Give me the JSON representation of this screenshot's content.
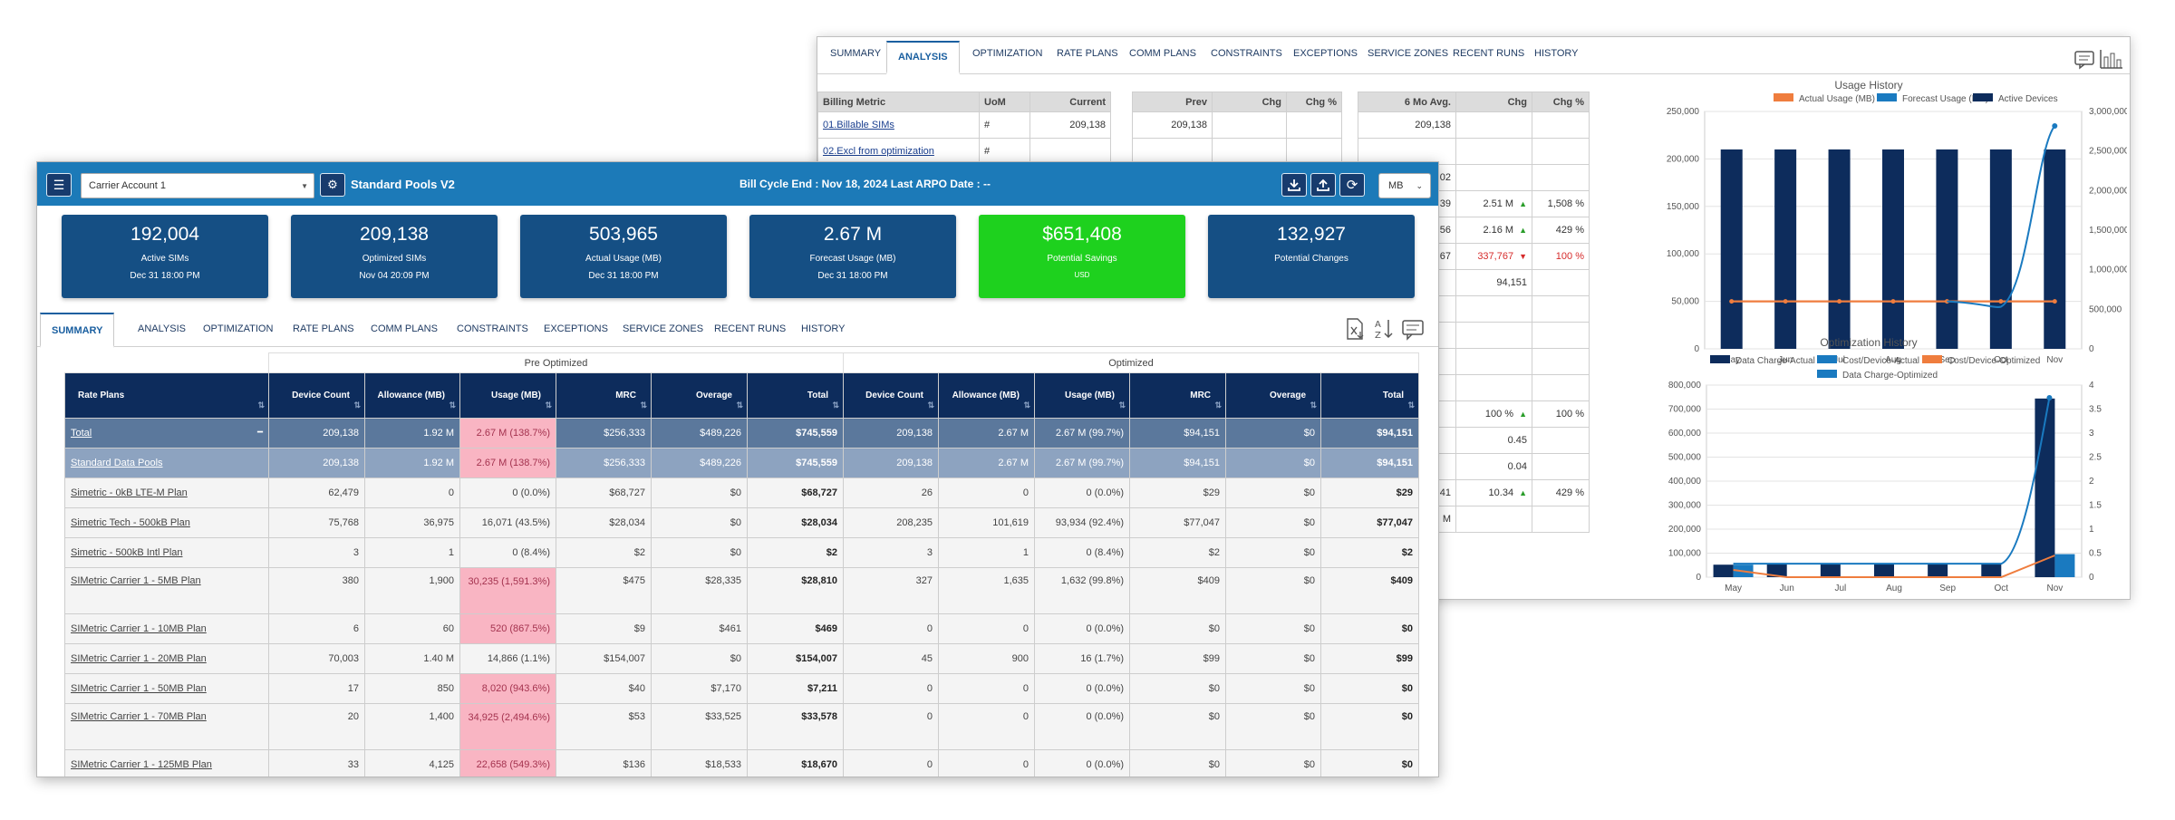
{
  "back": {
    "tabs": [
      "SUMMARY",
      "ANALYSIS",
      "OPTIMIZATION",
      "RATE PLANS",
      "COMM PLANS",
      "CONSTRAINTS",
      "EXCEPTIONS",
      "SERVICE ZONES",
      "RECENT RUNS",
      "HISTORY"
    ],
    "active_tab": "ANALYSIS",
    "metric_table": {
      "headers": [
        "Billing Metric",
        "UoM",
        "Current"
      ],
      "rows": [
        [
          "01.Billable SIMs",
          "#",
          "209,138"
        ],
        [
          "02.Excl from optimization",
          "#",
          ""
        ]
      ]
    },
    "prev_table": {
      "headers": [
        "Prev",
        "Chg",
        "Chg %"
      ],
      "rows": [
        [
          "209,138",
          "",
          ""
        ]
      ]
    },
    "avg_table": {
      "headers": [
        "6 Mo Avg.",
        "Chg",
        "Chg %"
      ],
      "rows": [
        [
          "209,138",
          "",
          ""
        ],
        [
          "",
          "",
          ""
        ],
        [
          "02",
          "",
          ""
        ],
        [
          "39",
          "2.51 M",
          "1,508 %"
        ],
        [
          "56",
          "2.16 M",
          "429 %"
        ],
        [
          "67",
          "337,767",
          "100 %"
        ],
        [
          "",
          "94,151",
          ""
        ],
        [
          "",
          "",
          ""
        ],
        [
          "",
          "",
          ""
        ],
        [
          "",
          "",
          ""
        ],
        [
          "",
          "",
          ""
        ],
        [
          "",
          "100 %",
          "100 %"
        ],
        [
          "",
          "0.45",
          ""
        ],
        [
          "",
          "0.04",
          ""
        ],
        [
          "41",
          "10.34",
          "429 %"
        ],
        [
          "M",
          "",
          ""
        ]
      ]
    },
    "usage_chart": {
      "title": "Usage History",
      "legend": [
        "Actual Usage (MB)",
        "Forecast Usage (MB)",
        "Active Devices"
      ],
      "y_left_ticks": [
        "250,000",
        "200,000",
        "150,000",
        "100,000",
        "50,000",
        "0"
      ],
      "y_right_ticks": [
        "3,000,000",
        "2,500,000",
        "2,000,000",
        "1,500,000",
        "1,000,000",
        "500,000",
        "0"
      ],
      "x": [
        "May",
        "Jun",
        "Jul",
        "Aug",
        "Sep",
        "Oct",
        "Nov"
      ]
    },
    "opt_chart": {
      "title": "Optimization History",
      "legend": [
        "Data Charge-Actual",
        "Cost/Device-Actual",
        "Cost/Device-Optimized",
        "Data Charge-Optimized"
      ],
      "y_left_ticks": [
        "800,000",
        "700,000",
        "600,000",
        "500,000",
        "400,000",
        "300,000",
        "200,000",
        "100,000",
        "0"
      ],
      "y_right_ticks": [
        "4",
        "3.5",
        "3",
        "2.5",
        "2",
        "1.5",
        "1",
        "0.5",
        "0"
      ],
      "x": [
        "May",
        "Jun",
        "Jul",
        "Aug",
        "Sep",
        "Oct",
        "Nov"
      ]
    }
  },
  "front": {
    "account": "Carrier Account 1",
    "pool_title": "Standard Pools V2",
    "cycle": "Bill Cycle End : Nov 18, 2024 Last ARPO Date : --",
    "unit": "MB",
    "kpis": [
      {
        "value": "192,004",
        "label": "Active SIMs",
        "date": "Dec 31 18:00 PM"
      },
      {
        "value": "209,138",
        "label": "Optimized SIMs",
        "date": "Nov 04 20:09 PM"
      },
      {
        "value": "503,965",
        "label": "Actual Usage (MB)",
        "date": "Dec 31 18:00 PM"
      },
      {
        "value": "2.67 M",
        "label": "Forecast Usage (MB)",
        "date": "Dec 31 18:00 PM"
      },
      {
        "value": "$651,408",
        "label": "Potential Savings",
        "date": "USD"
      },
      {
        "value": "132,927",
        "label": "Potential Changes",
        "date": ""
      }
    ],
    "tabs": [
      "SUMMARY",
      "ANALYSIS",
      "OPTIMIZATION",
      "RATE PLANS",
      "COMM PLANS",
      "CONSTRAINTS",
      "EXCEPTIONS",
      "SERVICE ZONES",
      "RECENT RUNS",
      "HISTORY"
    ],
    "active_tab": "SUMMARY",
    "table": {
      "group_pre": "Pre Optimized",
      "group_opt": "Optimized",
      "headers": [
        "Rate Plans",
        "Device Count",
        "Allowance (MB)",
        "Usage (MB)",
        "MRC",
        "Overage",
        "Total",
        "Device Count",
        "Allowance (MB)",
        "Usage (MB)",
        "MRC",
        "Overage",
        "Total"
      ],
      "rows": [
        [
          "Total",
          "209,138",
          "1.92 M",
          "2.67 M (138.7%)",
          "$256,333",
          "$489,226",
          "$745,559",
          "209,138",
          "2.67 M",
          "2.67 M (99.7%)",
          "$94,151",
          "$0",
          "$94,151"
        ],
        [
          "Standard Data Pools",
          "209,138",
          "1.92 M",
          "2.67 M (138.7%)",
          "$256,333",
          "$489,226",
          "$745,559",
          "209,138",
          "2.67 M",
          "2.67 M (99.7%)",
          "$94,151",
          "$0",
          "$94,151"
        ],
        [
          "Simetric - 0kB LTE-M Plan",
          "62,479",
          "0",
          "0 (0.0%)",
          "$68,727",
          "$0",
          "$68,727",
          "26",
          "0",
          "0 (0.0%)",
          "$29",
          "$0",
          "$29"
        ],
        [
          "Simetric Tech - 500kB Plan",
          "75,768",
          "36,975",
          "16,071 (43.5%)",
          "$28,034",
          "$0",
          "$28,034",
          "208,235",
          "101,619",
          "93,934 (92.4%)",
          "$77,047",
          "$0",
          "$77,047"
        ],
        [
          "Simetric - 500kB Intl Plan",
          "3",
          "1",
          "0 (8.4%)",
          "$2",
          "$0",
          "$2",
          "3",
          "1",
          "0 (8.4%)",
          "$2",
          "$0",
          "$2"
        ],
        [
          "SIMetric Carrier 1 - 5MB Plan",
          "380",
          "1,900",
          "30,235 (1,591.3%)",
          "$475",
          "$28,335",
          "$28,810",
          "327",
          "1,635",
          "1,632 (99.8%)",
          "$409",
          "$0",
          "$409"
        ],
        [
          "SIMetric Carrier 1 - 10MB Plan",
          "6",
          "60",
          "520 (867.5%)",
          "$9",
          "$461",
          "$469",
          "0",
          "0",
          "0 (0.0%)",
          "$0",
          "$0",
          "$0"
        ],
        [
          "SIMetric Carrier 1 - 20MB Plan",
          "70,003",
          "1.40 M",
          "14,866 (1.1%)",
          "$154,007",
          "$0",
          "$154,007",
          "45",
          "900",
          "16 (1.7%)",
          "$99",
          "$0",
          "$99"
        ],
        [
          "SIMetric Carrier 1 - 50MB Plan",
          "17",
          "850",
          "8,020 (943.6%)",
          "$40",
          "$7,170",
          "$7,211",
          "0",
          "0",
          "0 (0.0%)",
          "$0",
          "$0",
          "$0"
        ],
        [
          "SIMetric Carrier 1 - 70MB Plan",
          "20",
          "1,400",
          "34,925 (2,494.6%)",
          "$53",
          "$33,525",
          "$33,578",
          "0",
          "0",
          "0 (0.0%)",
          "$0",
          "$0",
          "$0"
        ],
        [
          "SIMetric Carrier 1 - 125MB Plan",
          "33",
          "4,125",
          "22,658 (549.3%)",
          "$136",
          "$18,533",
          "$18,670",
          "0",
          "0",
          "0 (0.0%)",
          "$0",
          "$0",
          "$0"
        ]
      ]
    }
  }
}
